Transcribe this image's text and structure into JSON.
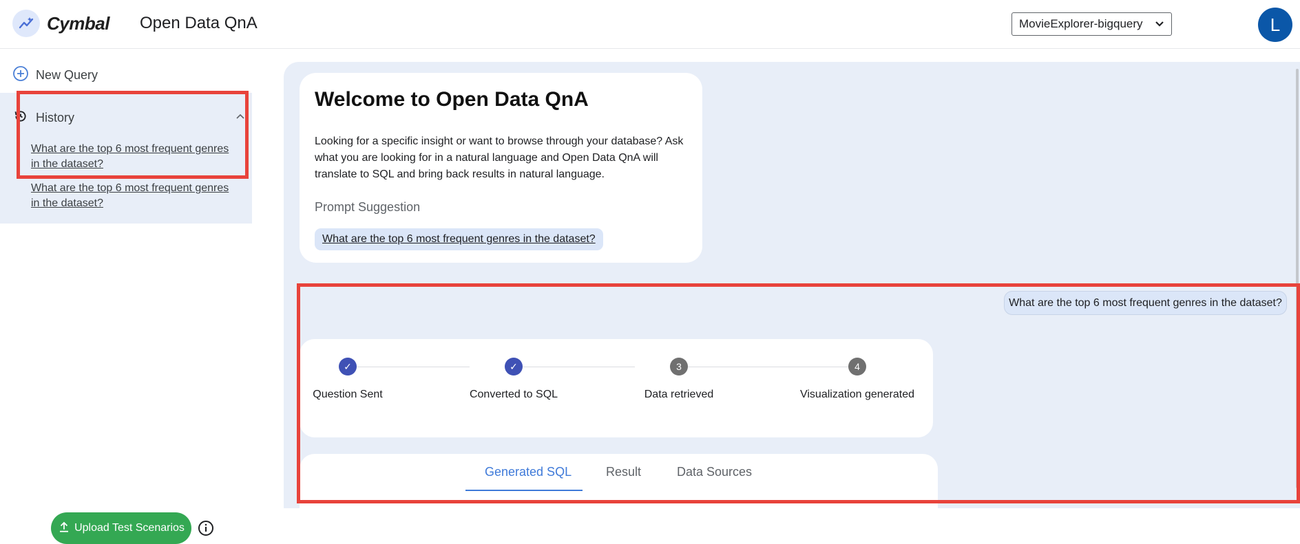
{
  "header": {
    "brand": "Cymbal",
    "app_title": "Open Data QnA",
    "datasource_selected": "MovieExplorer-bigquery",
    "avatar_letter": "L"
  },
  "sidebar": {
    "new_query_label": "New Query",
    "history_label": "History",
    "history_items": [
      "What are the top 6 most frequent genres in the dataset?",
      "What are the top 6 most frequent genres in the dataset?"
    ],
    "upload_label": "Upload Test Scenarios"
  },
  "welcome": {
    "title": "Welcome to Open Data QnA",
    "description": "Looking for a specific insight or want to browse through your database? Ask what you are looking for in a natural language and Open Data QnA will translate to SQL and bring back results in natural language.",
    "prompt_label": "Prompt Suggestion",
    "prompt_chip": "What are the top 6 most frequent genres in the dataset?"
  },
  "chat": {
    "user_message": "What are the top 6 most frequent genres in the dataset?"
  },
  "stepper": {
    "steps": [
      {
        "label": "Question Sent",
        "marker": "✓",
        "status": "done"
      },
      {
        "label": "Converted to SQL",
        "marker": "✓",
        "status": "done"
      },
      {
        "label": "Data retrieved",
        "marker": "3",
        "status": "pending"
      },
      {
        "label": "Visualization generated",
        "marker": "4",
        "status": "pending"
      }
    ]
  },
  "tabs": {
    "items": [
      "Generated SQL",
      "Result",
      "Data Sources"
    ],
    "active": "Generated SQL"
  },
  "colors": {
    "accent": "#3f51b5",
    "tab_active": "#3f7ad9",
    "upload_green": "#34a853",
    "highlight_red": "#e8433b",
    "main_bg": "#e8eef8"
  }
}
